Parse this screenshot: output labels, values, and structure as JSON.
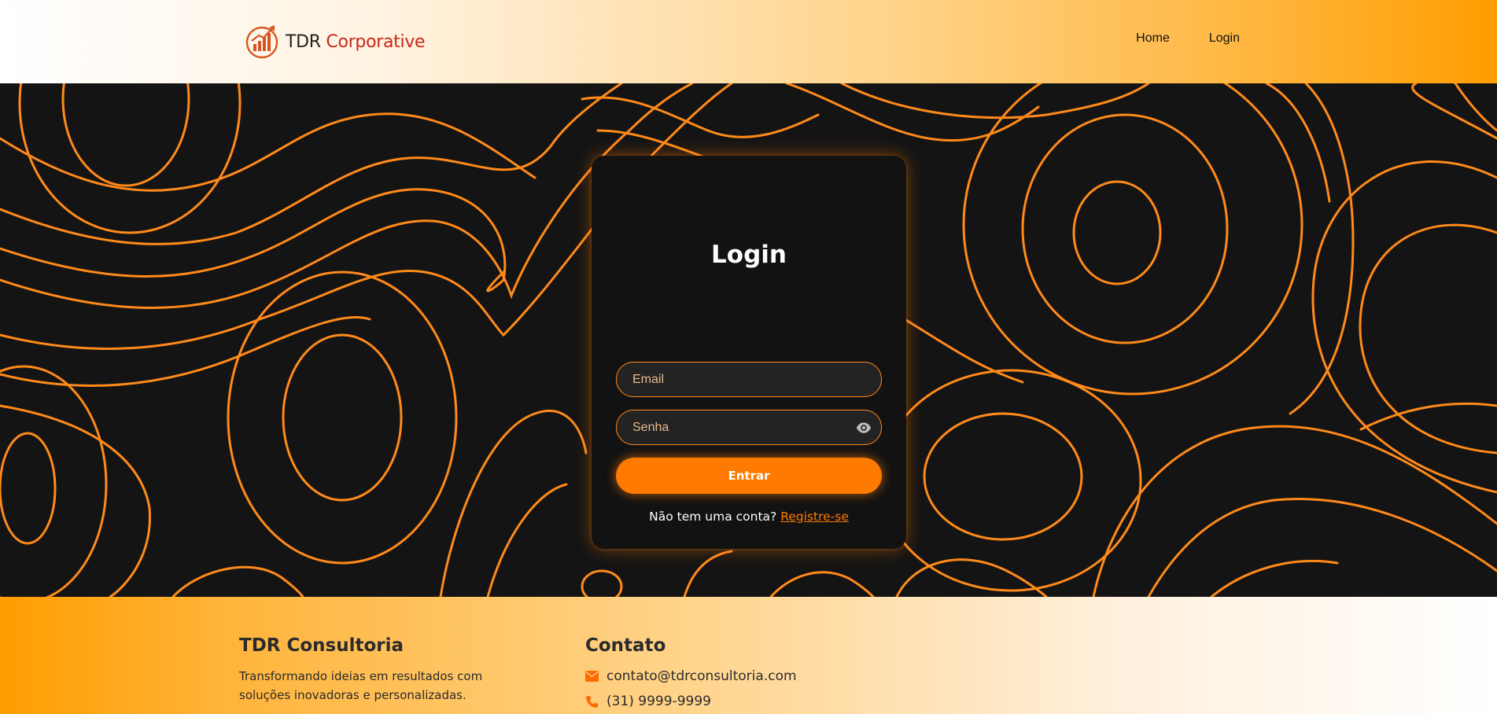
{
  "header": {
    "brand_name": "TDR",
    "brand_accent": "Corporative",
    "nav": {
      "home": "Home",
      "login": "Login"
    }
  },
  "login_card": {
    "title": "Login",
    "email_placeholder": "Email",
    "password_placeholder": "Senha",
    "submit_label": "Entrar",
    "signup_prompt": "Não tem uma conta?",
    "signup_link": "Registre-se"
  },
  "footer": {
    "company_title": "TDR Consultoria",
    "company_description": "Transformando ideias em resultados com soluções inovadoras e personalizadas.",
    "contact_title": "Contato",
    "contact_email": "contato@tdrconsultoria.com",
    "contact_phone": "(31) 9999-9999"
  },
  "colors": {
    "accent": "#ff7a00",
    "brand_red": "#c8281a",
    "card_background": "#121212",
    "hero_background": "#141414",
    "topo_line": "#ff8a1a"
  },
  "icons": {
    "logo": "growth-chart-logo-icon",
    "password_toggle": "eye-icon",
    "email": "envelope-icon",
    "phone": "phone-icon"
  }
}
